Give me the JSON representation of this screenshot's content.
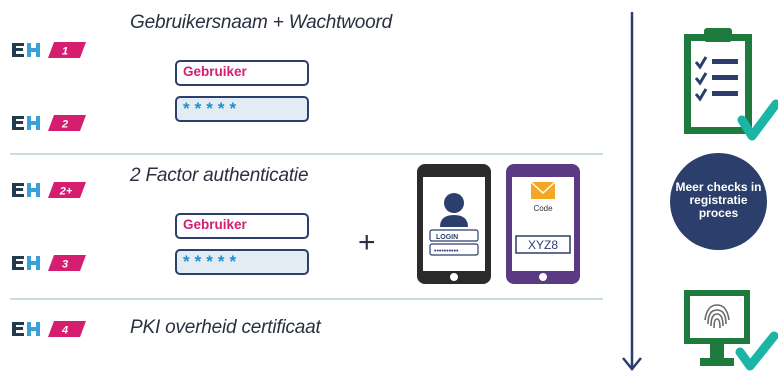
{
  "levels": [
    {
      "badge_num": "1",
      "color": "#d51e6f"
    },
    {
      "badge_num": "2",
      "color": "#d51e6f"
    },
    {
      "badge_num": "2+",
      "color": "#d51e6f"
    },
    {
      "badge_num": "3",
      "color": "#d51e6f"
    },
    {
      "badge_num": "4",
      "color": "#d51e6f"
    }
  ],
  "sections": {
    "s1_title": "Gebruikersnaam + Wachtwoord",
    "s2_title": "2 Factor authenticatie",
    "s3_title": "PKI overheid certificaat"
  },
  "login_form": {
    "username_label": "Gebruiker",
    "password_mask": "*****"
  },
  "plus_sign": "+",
  "phone1": {
    "button_label": "LOGIN",
    "password_dots": "••••••••••"
  },
  "phone2": {
    "code_label": "Code",
    "code_value": "XYZ8"
  },
  "checks_circle": {
    "text": "Meer checks in\nregistratie\nproces"
  },
  "colors": {
    "navy": "#2c3e6b",
    "magenta": "#d51e6f",
    "green": "#1e7a3d",
    "teal_check": "#1ab5a5",
    "purple_phone": "#5a3a82",
    "separator": "#c9dedd"
  },
  "icons": [
    "eh-logo-icon",
    "clipboard-checklist-icon",
    "checkmark-icon",
    "monitor-fingerprint-icon",
    "envelope-icon",
    "user-icon",
    "down-arrow-icon"
  ]
}
